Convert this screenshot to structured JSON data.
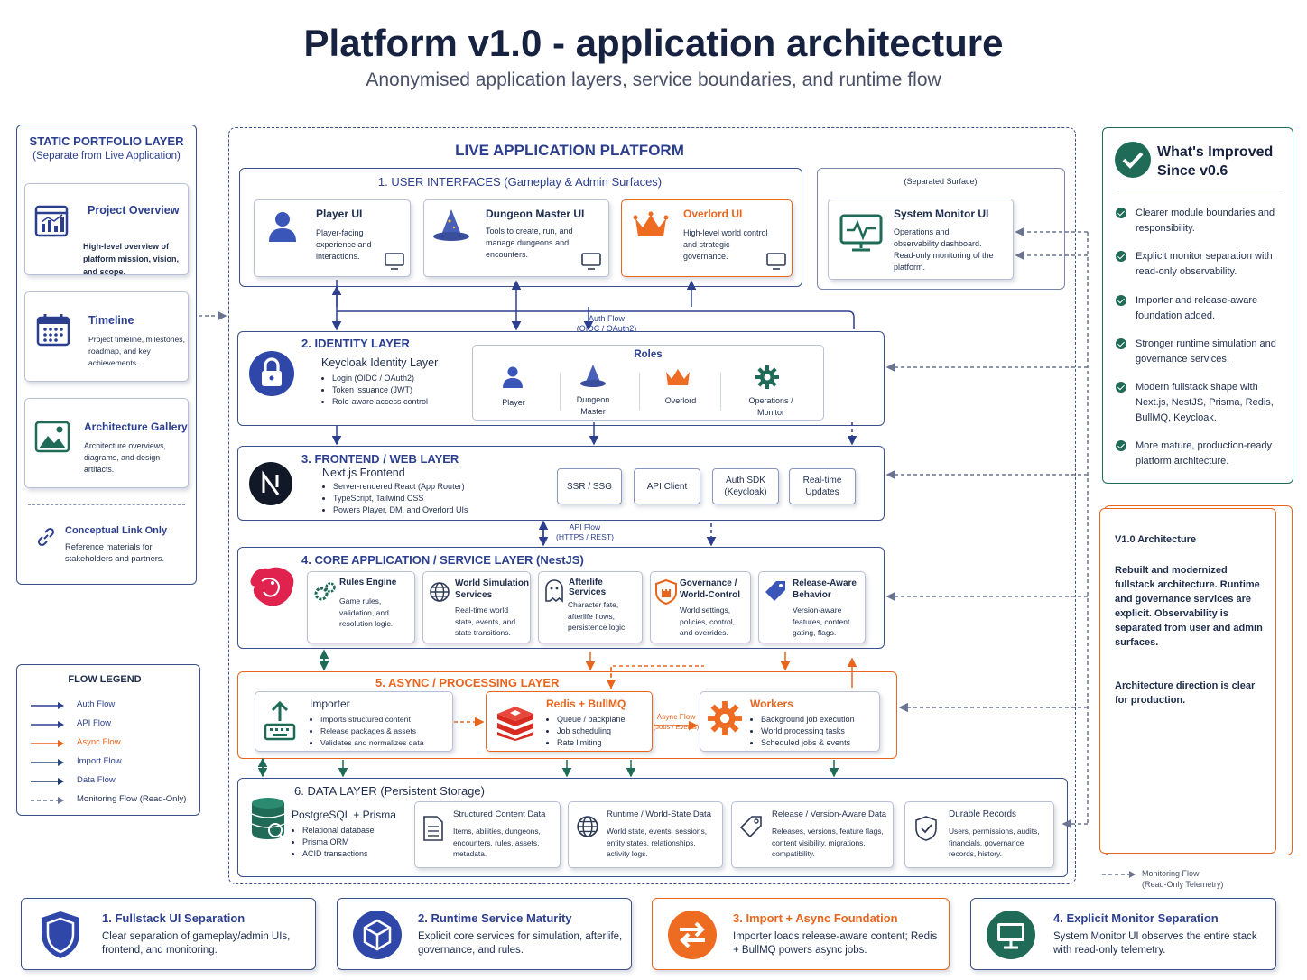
{
  "header": {
    "title": "Platform v1.0 - application architecture",
    "subtitle": "Anonymised application layers, service boundaries, and runtime flow"
  },
  "static_layer": {
    "title": "STATIC PORTFOLIO LAYER",
    "subtitle": "(Separate from Live Application)",
    "items": [
      {
        "title": "Project Overview",
        "desc": "High-level overview of platform mission, vision, and scope.",
        "icon": "chart-window-icon"
      },
      {
        "title": "Timeline",
        "desc": "Project timeline, milestones, roadmap, and key achievements.",
        "icon": "calendar-icon"
      },
      {
        "title": "Architecture Gallery",
        "desc": "Architecture overviews, diagrams, and design artifacts.",
        "icon": "image-icon"
      }
    ],
    "link_title": "Conceptual Link Only",
    "link_desc": "Reference materials for stakeholders and partners."
  },
  "legend": {
    "title": "FLOW LEGEND",
    "items": [
      {
        "label": "Auth Flow",
        "color": "#2c3f8f",
        "dashed": false
      },
      {
        "label": "API Flow",
        "color": "#2c3f8f",
        "dashed": false
      },
      {
        "label": "Async Flow",
        "color": "#e8651e",
        "dashed": false
      },
      {
        "label": "Import Flow",
        "color": "#2c4a7a",
        "dashed": false
      },
      {
        "label": "Data Flow",
        "color": "#1f3a6b",
        "dashed": false
      },
      {
        "label": "Monitoring Flow (Read-Only)",
        "color": "#6a7490",
        "dashed": true
      }
    ]
  },
  "platform": {
    "title": "LIVE APPLICATION PLATFORM",
    "ui_layer": {
      "title": "1. USER INTERFACES (Gameplay & Admin Surfaces)",
      "cards": [
        {
          "title": "Player UI",
          "desc": "Player-facing experience and interactions."
        },
        {
          "title": "Dungeon Master UI",
          "desc": "Tools to create, run, and manage dungeons and encounters."
        },
        {
          "title": "Overlord UI",
          "desc": "High-level world control and strategic governance."
        }
      ]
    },
    "separated": {
      "label": "(Separated Surface)",
      "title": "System Monitor UI",
      "desc": "Operations and observability dashboard. Read-only monitoring of the platform."
    },
    "auth_flow": {
      "line1": "Auth Flow",
      "line2": "(OIDC / OAuth2)"
    },
    "identity": {
      "title": "2. IDENTITY LAYER",
      "name": "Keycloak Identity Layer",
      "bullets": [
        "Login (OIDC / OAuth2)",
        "Token issuance (JWT)",
        "Role-aware access control"
      ],
      "roles_title": "Roles",
      "roles": [
        "Player",
        "Dungeon Master",
        "Overlord",
        "Operations / Monitor"
      ]
    },
    "frontend": {
      "title": "3. FRONTEND / WEB LAYER",
      "name": "Next.js Frontend",
      "bullets": [
        "Server-rendered React (App Router)",
        "TypeScript, Tailwind CSS",
        "Powers Player, DM, and Overlord UIs"
      ],
      "pills": [
        "SSR / SSG",
        "API Client",
        "Auth SDK (Keycloak)",
        "Real-time Updates"
      ]
    },
    "api_flow": {
      "line1": "API Flow",
      "line2": "(HTTPS / REST)"
    },
    "core": {
      "title": "4. CORE APPLICATION / SERVICE LAYER (NestJS)",
      "cards": [
        {
          "title": "Rules Engine",
          "desc": "Game rules, validation, and resolution logic."
        },
        {
          "title": "World Simulation Services",
          "desc": "Real-time world state, events, and state transitions."
        },
        {
          "title": "Afterlife Services",
          "desc": "Character fate, afterlife flows, persistence logic."
        },
        {
          "title": "Governance / World-Control",
          "desc": "World settings, policies, control, and overrides."
        },
        {
          "title": "Release-Aware Behavior",
          "desc": "Version-aware features, content gating, flags."
        }
      ]
    },
    "async": {
      "title": "5. ASYNC / PROCESSING LAYER",
      "importer": {
        "title": "Importer",
        "bullets": [
          "Imports structured content",
          "Release packages & assets",
          "Validates and normalizes data"
        ]
      },
      "redis": {
        "title": "Redis + BullMQ",
        "bullets": [
          "Queue / backplane",
          "Job scheduling",
          "Rate limiting"
        ]
      },
      "async_flow": {
        "line1": "Async Flow",
        "line2": "(Jobs / Events)"
      },
      "workers": {
        "title": "Workers",
        "bullets": [
          "Background job execution",
          "World processing tasks",
          "Scheduled jobs & events"
        ]
      }
    },
    "data": {
      "title": "6. DATA LAYER (Persistent Storage)",
      "pg": {
        "title": "PostgreSQL + Prisma",
        "bullets": [
          "Relational database",
          "Prisma ORM",
          "ACID transactions"
        ]
      },
      "cards": [
        {
          "title": "Structured Content Data",
          "desc": "Items, abilities, dungeons, encounters, rules, assets, metadata."
        },
        {
          "title": "Runtime / World-State Data",
          "desc": "World state, events, sessions, entity states, relationships, activity logs."
        },
        {
          "title": "Release / Version-Aware Data",
          "desc": "Releases, versions, feature flags, content visibility, migrations, compatibility."
        },
        {
          "title": "Durable Records",
          "desc": "Users, permissions, audits, financials, governance records, history."
        }
      ]
    }
  },
  "improved": {
    "title": "What's Improved Since v0.6",
    "items": [
      "Clearer module boundaries and responsibility.",
      "Explicit monitor separation with read-only observability.",
      "Importer and release-aware foundation added.",
      "Stronger runtime simulation and governance services.",
      "Modern fullstack shape with Next.js, NestJS, Prisma, Redis, BullMQ, Keycloak.",
      "More mature, production-ready platform architecture."
    ]
  },
  "v1": {
    "heading": "V1.0 Architecture",
    "para1": "Rebuilt and modernized fullstack architecture. Runtime and governance services are explicit. Observability is separated from user and admin surfaces.",
    "para2": "Architecture direction is clear for production."
  },
  "monitor_note": {
    "line1": "Monitoring Flow",
    "line2": "(Read-Only Telemetry)"
  },
  "highlights": [
    {
      "title": "1. Fullstack UI Separation",
      "desc": "Clear separation of gameplay/admin UIs, frontend, and monitoring."
    },
    {
      "title": "2. Runtime Service Maturity",
      "desc": "Explicit core services for simulation, afterlife, governance, and rules."
    },
    {
      "title": "3. Import + Async Foundation",
      "desc": "Importer loads release-aware content; Redis + BullMQ powers async jobs."
    },
    {
      "title": "4. Explicit Monitor Separation",
      "desc": "System Monitor UI observes the entire stack with read-only telemetry."
    }
  ]
}
